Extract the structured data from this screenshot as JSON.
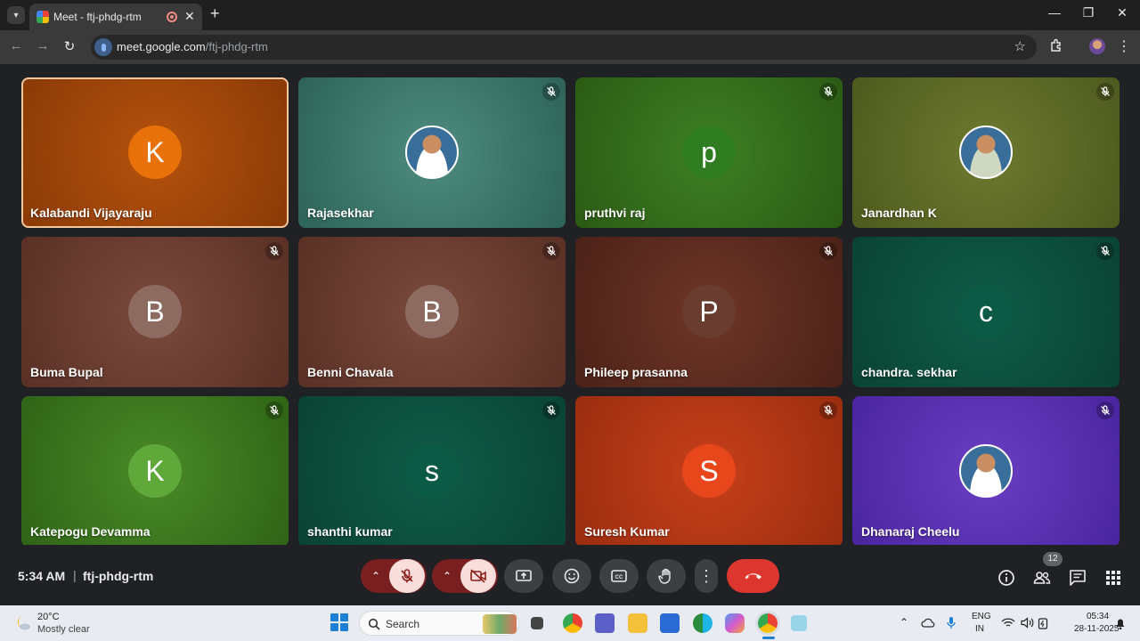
{
  "browser": {
    "tab_title": "Meet - ftj-phdg-rtm",
    "url_host": "meet.google.com",
    "url_path": "/ftj-phdg-rtm"
  },
  "tiles": [
    {
      "name": "Kalabandi Vijayaraju",
      "initial": "K",
      "avatar_color": "#e8710a",
      "bg": "radial-gradient(circle at 50% 50%, #b5520e, #8a3a06)",
      "muted": false,
      "active": true,
      "photo": false
    },
    {
      "name": "Rajasekhar",
      "initial": "",
      "avatar_color": "#ffffff",
      "bg": "radial-gradient(circle at 50% 50%, #4e8c7f, #2d6359)",
      "muted": true,
      "active": false,
      "photo": true
    },
    {
      "name": "pruthvi raj",
      "initial": "p",
      "avatar_color": "#2f7d20",
      "bg": "radial-gradient(circle at 50% 50%, #3e7f24, #2b5b14)",
      "muted": true,
      "active": false,
      "photo": false
    },
    {
      "name": "Janardhan K",
      "initial": "",
      "avatar_color": "#cfd8c0",
      "bg": "radial-gradient(circle at 50% 50%, #6e7a2f, #4e5a1e)",
      "muted": true,
      "active": false,
      "photo": true
    },
    {
      "name": "Buma Bupal",
      "initial": "B",
      "avatar_color": "#8d6b61",
      "bg": "radial-gradient(circle at 50% 50%, #7a4a3c, #5a3025)",
      "muted": true,
      "active": false,
      "photo": false
    },
    {
      "name": "Benni Chavala",
      "initial": "B",
      "avatar_color": "#8d6b61",
      "bg": "radial-gradient(circle at 50% 50%, #7a4a3c, #5a3025)",
      "muted": true,
      "active": false,
      "photo": false
    },
    {
      "name": "Phileep prasanna",
      "initial": "P",
      "avatar_color": "#6a3c30",
      "bg": "radial-gradient(circle at 50% 50%, #6e3526, #4c2218)",
      "muted": true,
      "active": false,
      "photo": false
    },
    {
      "name": "chandra. sekhar",
      "initial": "c",
      "avatar_color": "#0b5a45",
      "bg": "radial-gradient(circle at 50% 50%, #0f5c48, #0a4334)",
      "muted": true,
      "active": false,
      "photo": false
    },
    {
      "name": "Katepogu Devamma",
      "initial": "K",
      "avatar_color": "#5fa83a",
      "bg": "radial-gradient(circle at 50% 50%, #4a8a28, #2f6416)",
      "muted": true,
      "active": false,
      "photo": false
    },
    {
      "name": "shanthi kumar",
      "initial": "s",
      "avatar_color": "#0b5a45",
      "bg": "radial-gradient(circle at 50% 50%, #0f5c48, #0a4334)",
      "muted": true,
      "active": false,
      "photo": false
    },
    {
      "name": "Suresh Kumar",
      "initial": "S",
      "avatar_color": "#e8471c",
      "bg": "radial-gradient(circle at 50% 50%, #c8401a, #9a2d0f)",
      "muted": true,
      "active": false,
      "photo": false
    },
    {
      "name": "Dhanaraj Cheelu",
      "initial": "",
      "avatar_color": "#ffffff",
      "bg": "radial-gradient(circle at 50% 50%, #6a3ec2, #4a25a0)",
      "muted": true,
      "active": false,
      "photo": true
    }
  ],
  "meeting": {
    "time": "5:34 AM",
    "separator": "|",
    "code": "ftj-phdg-rtm",
    "people_count": "12"
  },
  "taskbar": {
    "temperature": "20°C",
    "condition": "Mostly clear",
    "search_label": "Search",
    "lang_1": "ENG",
    "lang_2": "IN",
    "time": "05:34",
    "date": "28-11-2025"
  }
}
